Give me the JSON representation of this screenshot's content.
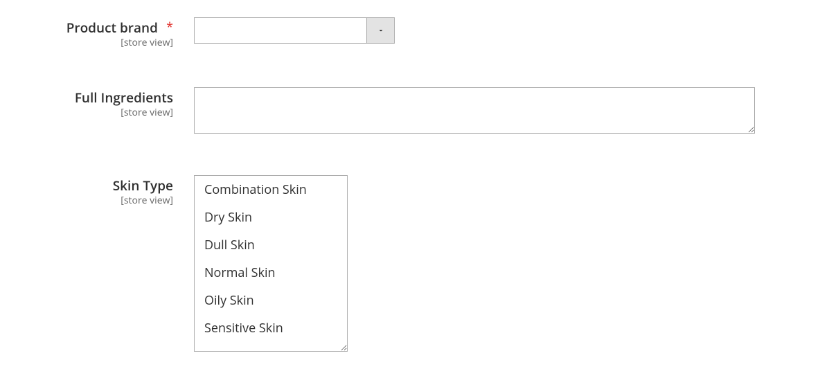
{
  "fields": {
    "product_brand": {
      "label": "Product brand",
      "scope": "[store view]",
      "required_mark": "*",
      "value": ""
    },
    "full_ingredients": {
      "label": "Full Ingredients",
      "scope": "[store view]",
      "value": ""
    },
    "skin_type": {
      "label": "Skin Type",
      "scope": "[store view]",
      "options": [
        "Combination Skin",
        "Dry Skin",
        "Dull Skin",
        "Normal Skin",
        "Oily Skin",
        "Sensitive Skin"
      ]
    }
  }
}
